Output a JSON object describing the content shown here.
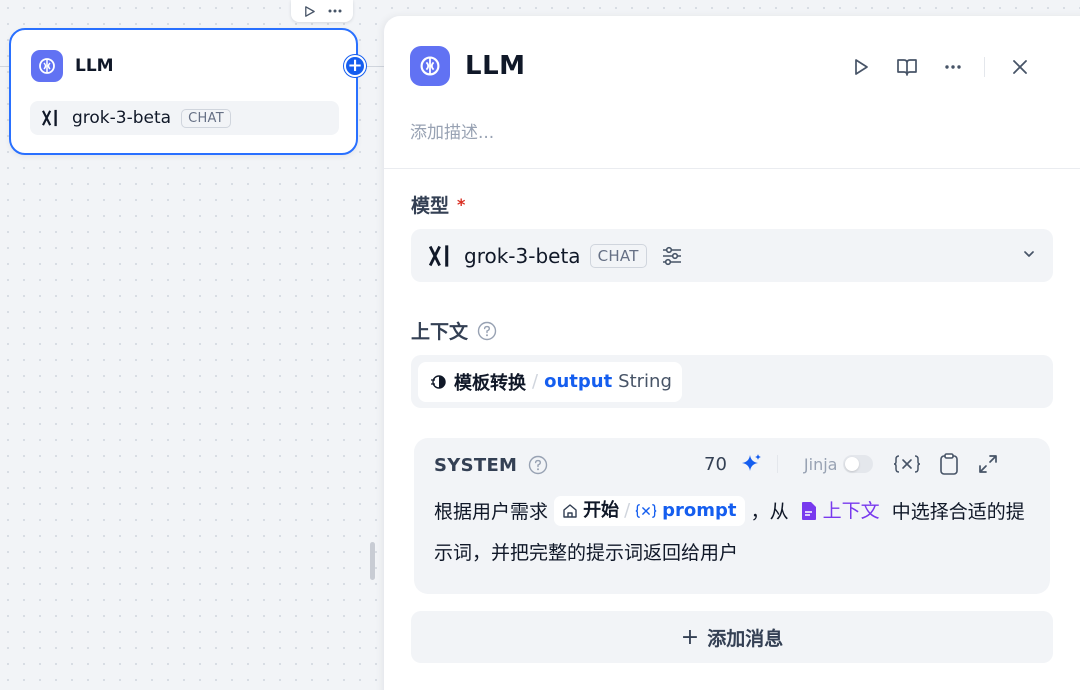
{
  "node": {
    "title": "LLM",
    "model": "grok-3-beta",
    "mode_tag": "CHAT"
  },
  "panel": {
    "title": "LLM",
    "description_placeholder": "添加描述...",
    "model_label": "模型",
    "required_mark": "*",
    "model_name": "grok-3-beta",
    "model_mode": "CHAT",
    "context_label": "上下文",
    "context_var": {
      "node": "模板转换",
      "separator": "/",
      "name": "output",
      "type": "String"
    },
    "system": {
      "title": "SYSTEM",
      "char_count": "70",
      "jinja_label": "Jinja",
      "text_before": "根据用户需求",
      "var_node": "开始",
      "var_separator": "/",
      "var_name": "prompt",
      "text_middle": "，从",
      "context_ref": "上下文",
      "text_after": "中选择合适的提示词，并把完整的提示词返回给用户"
    },
    "add_message_label": "添加消息"
  },
  "colors": {
    "accent": "#155eef",
    "llm_icon": "#6172f3",
    "node_border": "#2970ff",
    "context_purple": "#7839ee",
    "required_red": "#d92d20"
  }
}
